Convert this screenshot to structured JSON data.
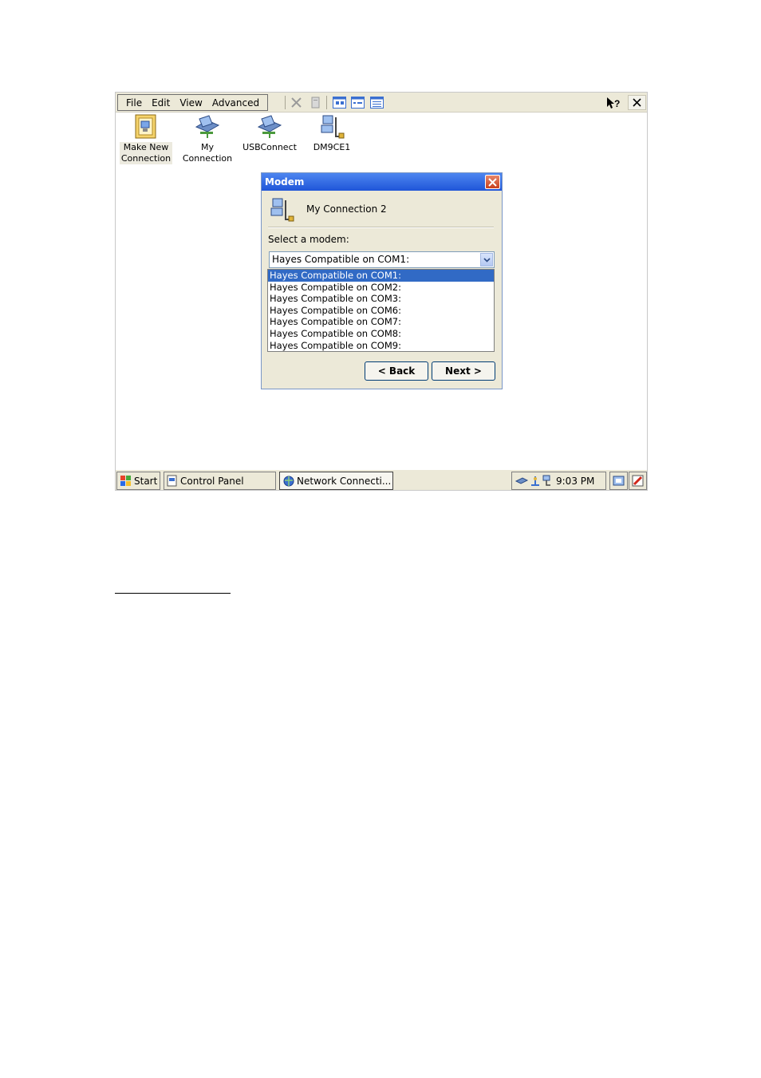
{
  "menu": {
    "items": [
      {
        "label": "File"
      },
      {
        "label": "Edit"
      },
      {
        "label": "View"
      },
      {
        "label": "Advanced"
      }
    ]
  },
  "toolbar": {
    "icons": [
      "delete-icon",
      "properties-icon",
      "large-icons-view-icon",
      "small-icons-view-icon",
      "details-view-icon",
      "help-icon",
      "close-icon"
    ]
  },
  "desktop_icons": [
    {
      "label_line1": "Make New",
      "label_line2": "Connection",
      "icon": "make-new-connection-icon"
    },
    {
      "label_line1": "My",
      "label_line2": "Connection",
      "icon": "network-connection-icon"
    },
    {
      "label_line1": "USBConnect",
      "label_line2": "",
      "icon": "network-connection-icon"
    },
    {
      "label_line1": "DM9CE1",
      "label_line2": "",
      "icon": "network-adapter-icon"
    }
  ],
  "dialog": {
    "title": "Modem",
    "connection_name": "My Connection 2",
    "select_label": "Select a modem:",
    "selected_modem": "Hayes Compatible on COM1:",
    "options": [
      "Hayes Compatible on COM1:",
      "Hayes Compatible on COM2:",
      "Hayes Compatible on COM3:",
      "Hayes Compatible on COM6:",
      "Hayes Compatible on COM7:",
      "Hayes Compatible on COM8:",
      "Hayes Compatible on COM9:"
    ],
    "back_label": "< Back",
    "next_label": "Next >"
  },
  "taskbar": {
    "start_label": "Start",
    "tasks": [
      {
        "label": "Control Panel"
      },
      {
        "label": "Network Connecti..."
      }
    ],
    "clock": "9:03 PM"
  },
  "colors": {
    "title_bar": "#2b63e0",
    "selection": "#316ac5",
    "chrome": "#ece9d8"
  }
}
